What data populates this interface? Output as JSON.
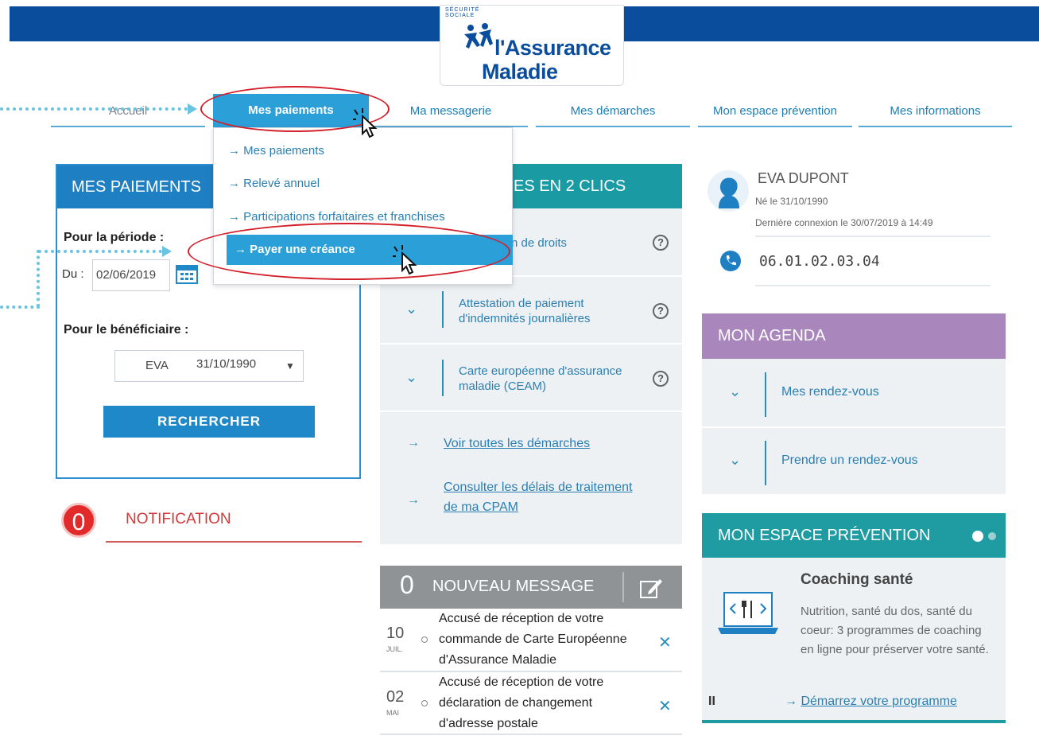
{
  "logo": {
    "arc_text": "SÉCURITÉ SOCIALE",
    "line1": "l'Assurance",
    "line2": "Maladie"
  },
  "nav": {
    "items": [
      {
        "label": "Accueil"
      },
      {
        "label": "Mes paiements"
      },
      {
        "label": "Ma messagerie"
      },
      {
        "label": "Mes démarches"
      },
      {
        "label": "Mon espace prévention"
      },
      {
        "label": "Mes informations"
      }
    ],
    "active_index": 1
  },
  "dropdown": {
    "items": [
      "→ Mes paiements",
      "→ Relevé annuel",
      "→ Participations forfaitaires et franchises",
      "→ Payer une créance"
    ]
  },
  "payments_panel": {
    "title": "MES PAIEMENTS",
    "period_label": "Pour la période :",
    "from_label": "Du :",
    "from_value": "02/06/2019",
    "beneficiary_label": "Pour le bénéficiaire :",
    "beneficiary_name": "EVA",
    "beneficiary_birth": "31/10/1990",
    "search_button": "RECHERCHER"
  },
  "notification": {
    "count": "0",
    "label": "NOTIFICATION"
  },
  "demarches_panel": {
    "title_visible": "ES EN 2 CLICS",
    "rows": [
      {
        "text": "n de droits"
      },
      {
        "text": "Attestation de paiement\nd'indemnités journalières"
      },
      {
        "text": "Carte européenne d'assurance\nmaladie (CEAM)"
      }
    ],
    "links": [
      "Voir toutes les démarches",
      "Consulter les délais de traitement",
      "de ma CPAM"
    ],
    "help_symbol": "?"
  },
  "messages": {
    "count": "0",
    "title": "NOUVEAU MESSAGE",
    "items": [
      {
        "day": "10",
        "month": "JUIL.",
        "lines": [
          "Accusé de réception de votre",
          "commande de Carte Européenne",
          "d'Assurance Maladie"
        ]
      },
      {
        "day": "02",
        "month": "MAI",
        "lines": [
          "Accusé de réception de votre",
          "déclaration de changement",
          "d'adresse postale"
        ]
      }
    ],
    "close_symbol": "✕"
  },
  "user": {
    "name": "EVA DUPONT",
    "birth": "Né le 31/10/1990",
    "last_login": "Dernière connexion le 30/07/2019 à 14:49",
    "phone": "06.01.02.03.04"
  },
  "agenda": {
    "title": "MON AGENDA",
    "items": [
      "Mes rendez-vous",
      "Prendre un rendez-vous"
    ]
  },
  "prevention": {
    "title": "MON ESPACE PRÉVENTION",
    "card_title": "Coaching santé",
    "card_body": "Nutrition, santé du dos, santé du coeur: 3 programmes de coaching en ligne pour préserver votre santé.",
    "link": "Démarrez votre programme",
    "link_arrow": "→",
    "pause_symbol": "II"
  },
  "colors": {
    "brand_blue": "#0a4d9c",
    "active_nav": "#2b9fd8",
    "teal": "#1a9aa3",
    "purple": "#a987bd",
    "annotation_red": "#d4202b",
    "guide_cyan": "#6ac3e0"
  },
  "icons": [
    "calendar-icon",
    "help-icon",
    "chevron-down-icon",
    "arrow-right-icon",
    "edit-icon",
    "close-icon",
    "avatar-icon",
    "phone-icon",
    "laptop-icon",
    "cursor-icon"
  ]
}
